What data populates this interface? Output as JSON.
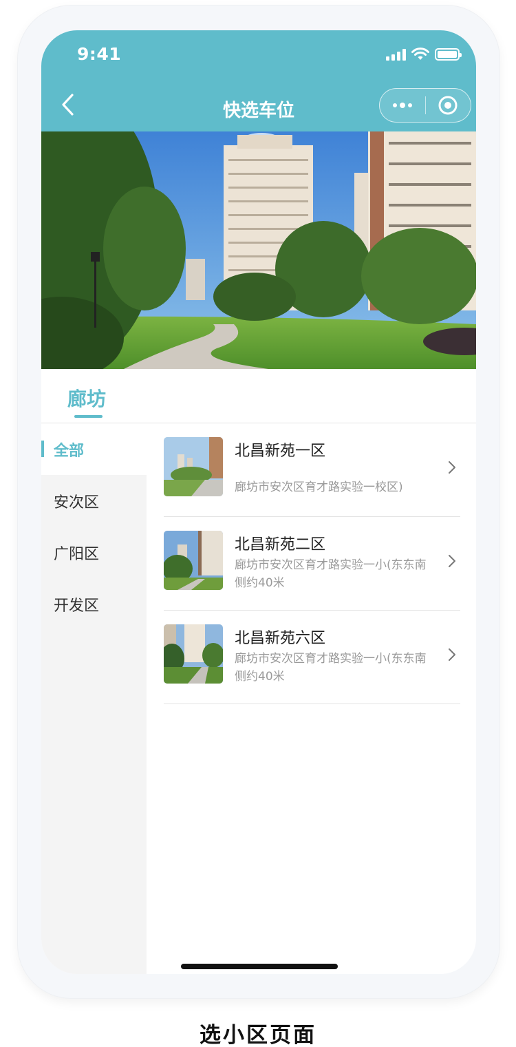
{
  "status_bar": {
    "time": "9:41"
  },
  "nav": {
    "title": "快选车位"
  },
  "city_tab": {
    "label": "廊坊"
  },
  "districts": [
    {
      "label": "全部",
      "active": true
    },
    {
      "label": "安次区",
      "active": false
    },
    {
      "label": "广阳区",
      "active": false
    },
    {
      "label": "开发区",
      "active": false
    }
  ],
  "communities": [
    {
      "name": "北昌新苑一区",
      "address": "廊坊市安次区育才路实验一校区)"
    },
    {
      "name": "北昌新苑二区",
      "address": "廊坊市安次区育才路实验一小(东东南侧约40米"
    },
    {
      "name": "北昌新苑六区",
      "address": "廊坊市安次区育才路实验一小(东东南侧约40米"
    }
  ],
  "caption": "选小区页面",
  "colors": {
    "accent": "#5fbccb",
    "sidebar_bg": "#f4f4f4"
  }
}
